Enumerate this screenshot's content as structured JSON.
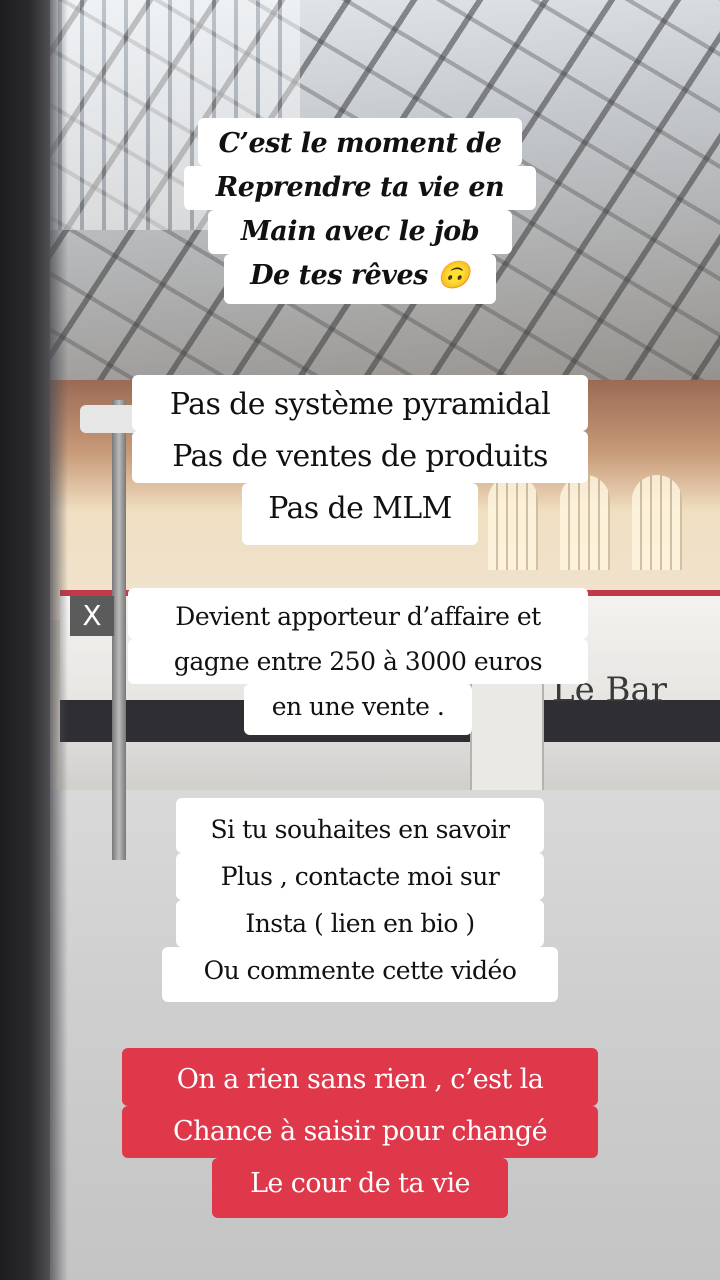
{
  "background": {
    "sign_x": "X",
    "train_sign": "Le Bar"
  },
  "captions": {
    "intro": [
      "C’est le moment de",
      "Reprendre ta vie en",
      "Main avec le job",
      "De tes rêves 🙃"
    ],
    "no_list": [
      "Pas de système pyramidal",
      "Pas de ventes de produits",
      "Pas de MLM"
    ],
    "offer": [
      "Devient apporteur d’affaire et",
      "gagne entre 250 à 3000 euros",
      "en une vente ."
    ],
    "contact": [
      "Si tu souhaites en savoir",
      "Plus , contacte moi sur",
      "Insta ( lien en bio )",
      "Ou commente cette vidéo"
    ],
    "closing": [
      "On a rien sans rien , c’est la",
      "Chance à saisir pour changé",
      "Le cour de ta vie"
    ]
  },
  "colors": {
    "sticker_white": "#ffffff",
    "sticker_red": "#e0384b",
    "text_dark": "#111111",
    "text_light": "#ffffff"
  }
}
